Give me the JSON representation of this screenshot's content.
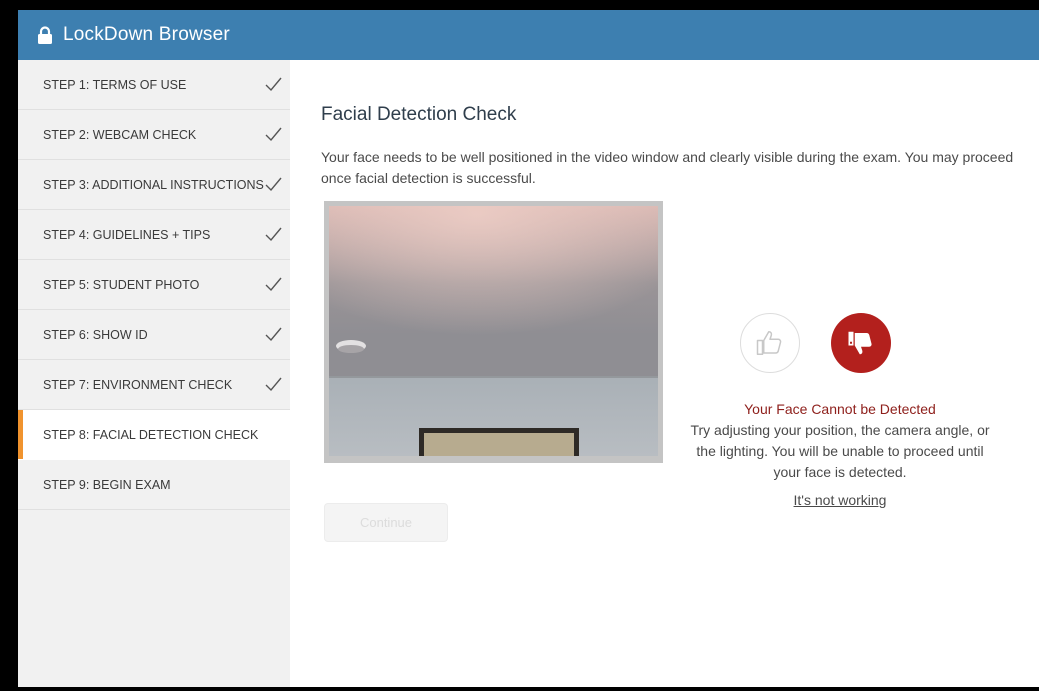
{
  "app": {
    "title": "LockDown Browser",
    "accent_color": "#3d7fb0"
  },
  "sidebar": {
    "active_color": "#f0932e",
    "items": [
      {
        "label": "STEP 1: TERMS OF USE",
        "completed": true
      },
      {
        "label": "STEP 2: WEBCAM CHECK",
        "completed": true
      },
      {
        "label": "STEP 3: ADDITIONAL INSTRUCTIONS",
        "completed": true
      },
      {
        "label": "STEP 4: GUIDELINES + TIPS",
        "completed": true
      },
      {
        "label": "STEP 5: STUDENT PHOTO",
        "completed": true
      },
      {
        "label": "STEP 6: SHOW ID",
        "completed": true
      },
      {
        "label": "STEP 7: ENVIRONMENT CHECK",
        "completed": true
      },
      {
        "label": "STEP 8: FACIAL DETECTION CHECK",
        "completed": false,
        "active": true
      },
      {
        "label": "STEP 9: BEGIN EXAM",
        "completed": false
      }
    ]
  },
  "main": {
    "title": "Facial Detection Check",
    "description": "Your face needs to be well positioned in the video window and clearly visible during the exam. You may proceed once facial detection is successful.",
    "continue_label": "Continue",
    "continue_enabled": false
  },
  "status": {
    "title": "Your Face Cannot be Detected",
    "message": "Try adjusting your position, the camera angle, or the lighting. You will be unable to proceed until your face is detected.",
    "help_link": "It's not working",
    "thumbs_up_icon": "thumbs-up-icon",
    "thumbs_down_icon": "thumbs-down-icon",
    "error_color": "#b3201d"
  }
}
